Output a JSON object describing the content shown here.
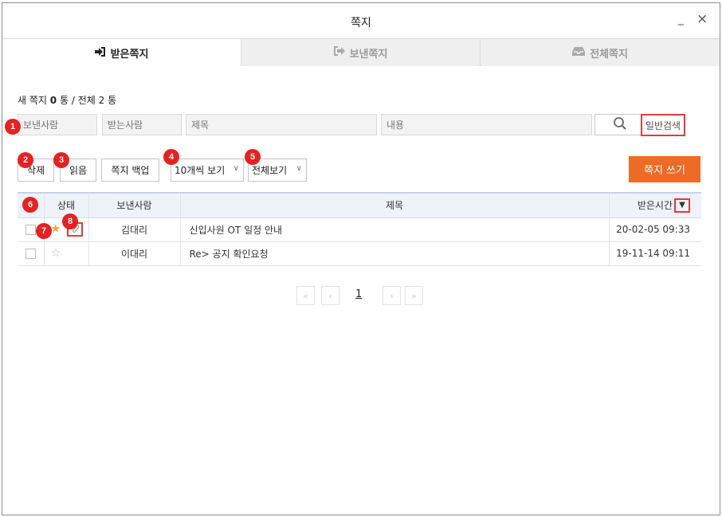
{
  "window": {
    "title": "쪽지",
    "minimize": "_",
    "close": "×"
  },
  "tabs": [
    {
      "label": "받은쪽지",
      "icon": "sign-in-icon",
      "active": true
    },
    {
      "label": "보낸쪽지",
      "icon": "sign-out-icon",
      "active": false
    },
    {
      "label": "전체쪽지",
      "icon": "inbox-icon",
      "active": false
    }
  ],
  "counts": {
    "new_label": "새 쪽지",
    "new_count": "0",
    "new_unit": "통",
    "separator": "/",
    "total_label": "전체",
    "total_count": "2",
    "total_unit": "통"
  },
  "search": {
    "sender_placeholder": "보낸사람",
    "receiver_placeholder": "받는사람",
    "subject_placeholder": "제목",
    "content_placeholder": "내용",
    "mode_label": "일반검색"
  },
  "toolbar": {
    "delete_label": "삭제",
    "read_label": "읽음",
    "backup_label": "쪽지 백업",
    "page_size": "10개씩 보기",
    "filter": "전체보기",
    "write_label": "쪽지 쓰기"
  },
  "table": {
    "columns": {
      "status": "상태",
      "sender": "보낸사람",
      "subject": "제목",
      "received": "받은시간"
    },
    "rows": [
      {
        "starred": true,
        "attachment": true,
        "sender": "김대리",
        "subject": "신입사원 OT 일정 안내",
        "received": "20-02-05 09:33"
      },
      {
        "starred": false,
        "attachment": false,
        "sender": "이대리",
        "subject": "Re> 공지 확인요청",
        "received": "19-11-14 09:11"
      }
    ]
  },
  "pagination": {
    "current": "1"
  },
  "badges": [
    "1",
    "2",
    "3",
    "4",
    "5",
    "6",
    "7",
    "8"
  ],
  "colors": {
    "accent": "#ed6b25",
    "highlight": "#e03c3c",
    "badge": "#e8211f",
    "star": "#f5a623"
  }
}
